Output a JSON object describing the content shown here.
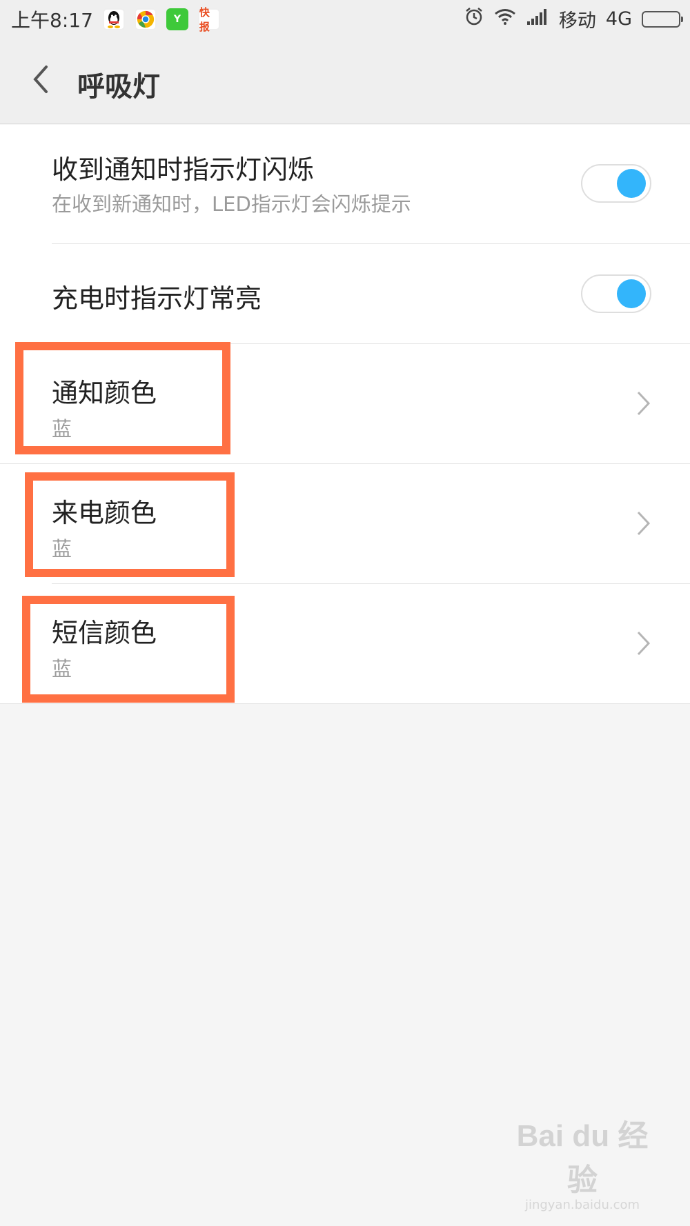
{
  "status_bar": {
    "time": "上午8:17",
    "apps": [
      {
        "name": "qq-icon"
      },
      {
        "name": "browser-icon"
      },
      {
        "name": "green-app-icon",
        "glyph": "Y"
      },
      {
        "name": "news-app-icon",
        "glyph": "快报"
      }
    ],
    "carrier": "移动",
    "network": "4G",
    "battery_color": "#ff8a1a"
  },
  "header": {
    "title": "呼吸灯",
    "back_icon": "chevron-left-icon"
  },
  "settings": {
    "notify_blink": {
      "title": "收到通知时指示灯闪烁",
      "subtitle": "在收到新通知时，LED指示灯会闪烁提示",
      "enabled": true
    },
    "charging_on": {
      "title": "充电时指示灯常亮",
      "enabled": true
    },
    "notify_color": {
      "title": "通知颜色",
      "value": "蓝"
    },
    "call_color": {
      "title": "来电颜色",
      "value": "蓝"
    },
    "sms_color": {
      "title": "短信颜色",
      "value": "蓝"
    }
  },
  "colors": {
    "accent": "#33b5fb",
    "highlight": "#ff7043",
    "background": "#f5f5f5",
    "header_bg": "#efefef"
  },
  "watermark": {
    "logo": "Bai du 经验",
    "url": "jingyan.baidu.com"
  }
}
